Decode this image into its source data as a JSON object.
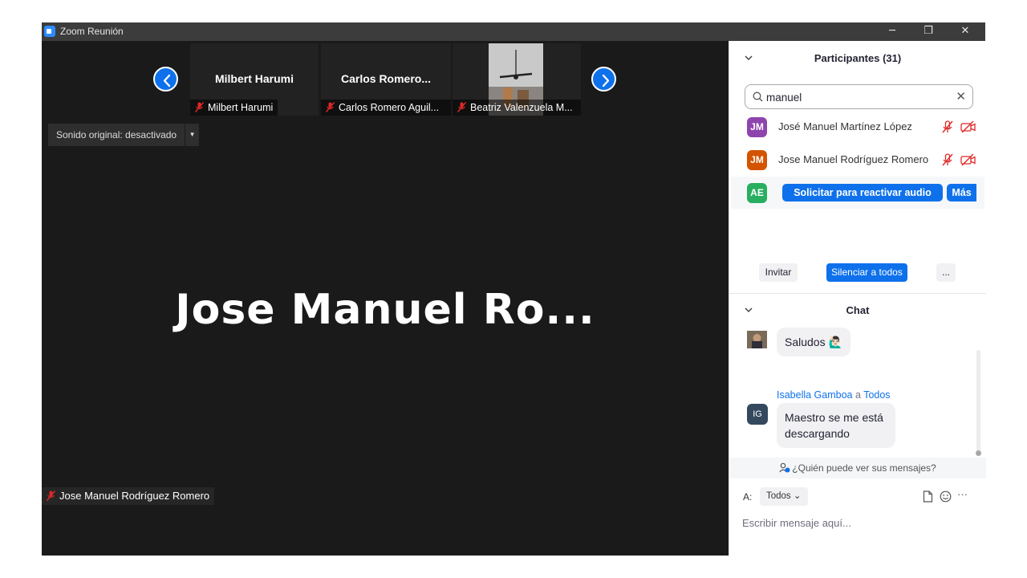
{
  "window": {
    "title": "Zoom Reunión",
    "minimize": "─",
    "maximize": "❐",
    "close": "✕"
  },
  "gallery": {
    "tiles": [
      {
        "name": "Milbert Harumi",
        "label": "Milbert Harumi"
      },
      {
        "name": "Carlos  Romero...",
        "label": "Carlos Romero Aguil..."
      },
      {
        "name": "",
        "label": "Beatriz Valenzuela M..."
      }
    ]
  },
  "audio_option": {
    "label": "Sonido original: desactivado",
    "arrow": "▼"
  },
  "speaker": {
    "display": "Jose  Manuel  Ro...",
    "label": "Jose Manuel Rodríguez Romero"
  },
  "participants": {
    "title": "Participantes (31)",
    "search": {
      "value": "manuel",
      "clear": "✕"
    },
    "list": [
      {
        "initials": "JM",
        "name": "José Manuel Martínez López",
        "color": "#8e44ad"
      },
      {
        "initials": "JM",
        "name": "Jose Manuel Rodríguez Romero",
        "color": "#d35400"
      },
      {
        "initials": "AE",
        "color": "#27ae60",
        "action": "Solicitar para reactivar audio",
        "more": "Más"
      }
    ],
    "buttons": {
      "invite": "Invitar",
      "mute_all": "Silenciar a todos",
      "more": "..."
    }
  },
  "chat": {
    "title": "Chat",
    "messages": [
      {
        "text": "Saludos 🙋🏻‍♂️"
      },
      {
        "sender": "Isabella Gamboa",
        "connector": "a",
        "recipient": "Todos",
        "initials": "IG",
        "line1": "Maestro se me está",
        "line2": "descargando"
      }
    ],
    "who_can_see": "¿Quién puede ver sus mensajes?",
    "to_label": "A:",
    "to_value": "Todos",
    "to_arrow": "⌄",
    "placeholder": "Escribir mensaje aquí...",
    "more": "···"
  },
  "colors": {
    "accent": "#0e71eb",
    "video_bg": "#1a1a1a",
    "muted": "#e02828"
  }
}
